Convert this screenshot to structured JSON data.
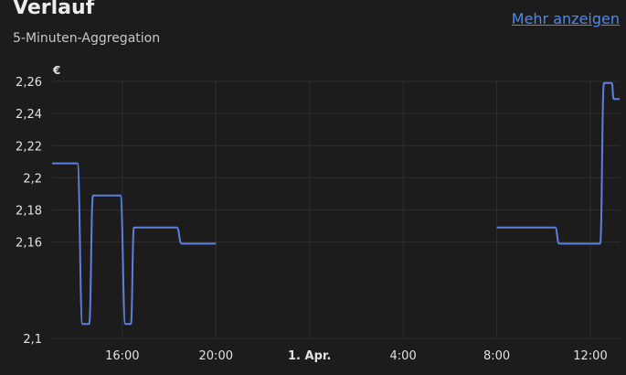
{
  "card": {
    "title": "Verlauf",
    "subtitle": "5-Minuten-Aggregation",
    "more_link": "Mehr anzeigen"
  },
  "colors": {
    "background": "#1c1c1c",
    "grid": "#2e2e2e",
    "line": "#5b80e0",
    "link": "#4b8af1",
    "text": "#e1e1e1"
  },
  "chart_data": {
    "type": "line",
    "unit": "€",
    "ylim": [
      2.1,
      2.26
    ],
    "y_ticks": [
      {
        "value": 2.26,
        "label": "2,26"
      },
      {
        "value": 2.24,
        "label": "2,24"
      },
      {
        "value": 2.22,
        "label": "2,22"
      },
      {
        "value": 2.2,
        "label": "2,2"
      },
      {
        "value": 2.18,
        "label": "2,18"
      },
      {
        "value": 2.16,
        "label": "2,16"
      },
      {
        "value": 2.1,
        "label": "2,1"
      }
    ],
    "x_range": [
      "2024-03-31T13:00",
      "2024-04-01T13:15"
    ],
    "x_ticks": [
      {
        "t": "2024-03-31T16:00",
        "label": "16:00",
        "bold": false
      },
      {
        "t": "2024-03-31T20:00",
        "label": "20:00",
        "bold": false
      },
      {
        "t": "2024-04-01T00:00",
        "label": "1. Apr.",
        "bold": true
      },
      {
        "t": "2024-04-01T04:00",
        "label": "4:00",
        "bold": false
      },
      {
        "t": "2024-04-01T08:00",
        "label": "8:00",
        "bold": false
      },
      {
        "t": "2024-04-01T12:00",
        "label": "12:00",
        "bold": false
      }
    ],
    "grid": true,
    "series": [
      {
        "color": "#5b80e0",
        "segments": [
          [
            [
              "2024-03-31T13:00",
              2.209
            ],
            [
              "2024-03-31T14:05",
              2.209
            ],
            [
              "2024-03-31T14:18",
              2.109
            ],
            [
              "2024-03-31T14:35",
              2.109
            ],
            [
              "2024-03-31T14:45",
              2.189
            ],
            [
              "2024-03-31T15:55",
              2.189
            ],
            [
              "2024-03-31T16:08",
              2.109
            ],
            [
              "2024-03-31T16:22",
              2.109
            ],
            [
              "2024-03-31T16:30",
              2.169
            ],
            [
              "2024-03-31T18:20",
              2.169
            ],
            [
              "2024-03-31T18:32",
              2.159
            ],
            [
              "2024-03-31T20:00",
              2.159
            ]
          ],
          [
            [
              "2024-04-01T08:00",
              2.169
            ],
            [
              "2024-04-01T10:30",
              2.169
            ],
            [
              "2024-04-01T10:40",
              2.159
            ],
            [
              "2024-04-01T12:25",
              2.159
            ],
            [
              "2024-04-01T12:35",
              2.259
            ],
            [
              "2024-04-01T12:55",
              2.259
            ],
            [
              "2024-04-01T13:00",
              2.249
            ],
            [
              "2024-04-01T13:15",
              2.249
            ]
          ]
        ]
      }
    ]
  }
}
